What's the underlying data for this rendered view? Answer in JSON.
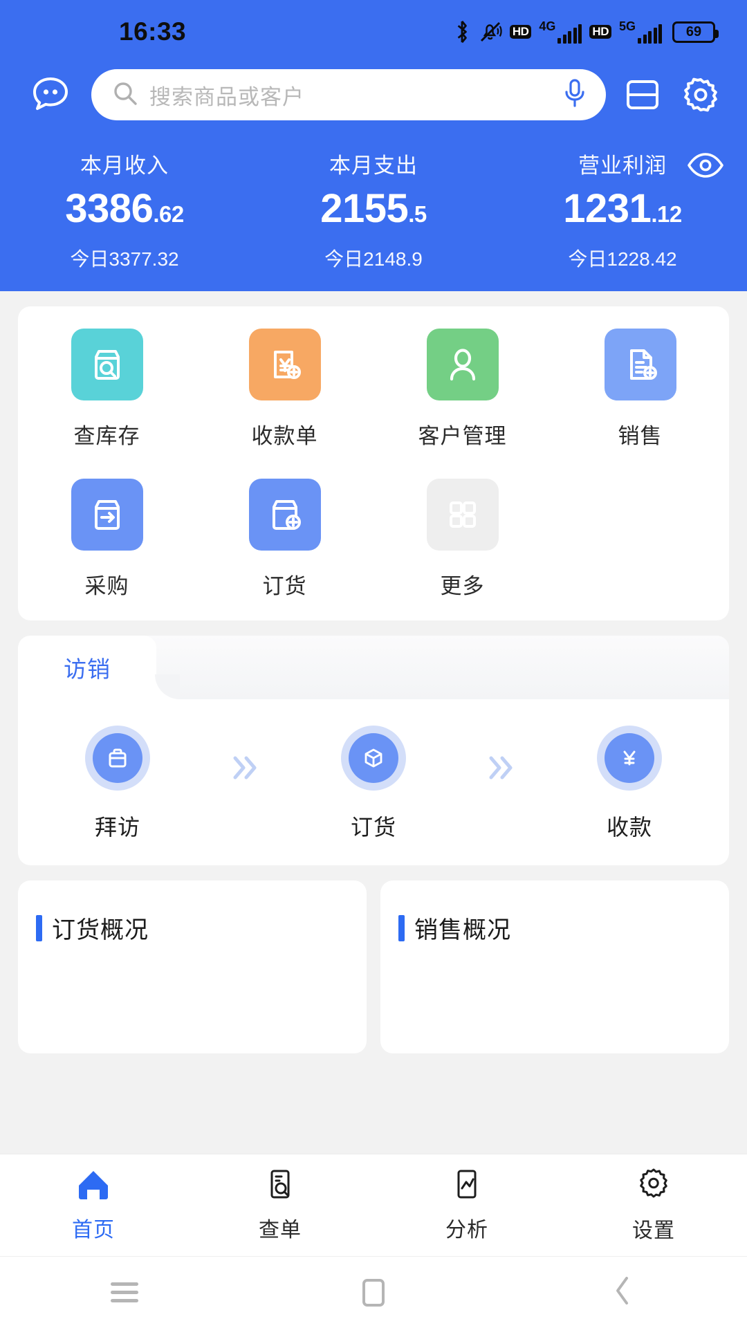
{
  "statusbar": {
    "time": "16:33",
    "icons": [
      "bluetooth-icon",
      "mute-vibrate-icon",
      "hd-icon",
      "signal-4g-icon",
      "hd-icon-2",
      "signal-5g-icon",
      "battery-icon"
    ],
    "network_1": "4G",
    "network_2": "5G",
    "hd_label": "HD",
    "battery_level": "69"
  },
  "header": {
    "chat_icon": "chat-bubble-icon",
    "search": {
      "placeholder": "搜索商品或客户",
      "search_icon": "search-icon",
      "mic_icon": "microphone-icon"
    },
    "scan_icon": "scan-card-icon",
    "settings_icon": "gear-icon",
    "eye_icon": "eye-visibility-icon",
    "accent_color": "#3b6ef0",
    "stats": [
      {
        "label": "本月收入",
        "int": "3386",
        "dec": ".62",
        "sub": "今日3377.32"
      },
      {
        "label": "本月支出",
        "int": "2155",
        "dec": ".5",
        "sub": "今日2148.9"
      },
      {
        "label": "营业利润",
        "int": "1231",
        "dec": ".12",
        "sub": "今日1228.42"
      }
    ]
  },
  "quick_actions": {
    "row1": [
      {
        "label": "查库存",
        "icon": "box-search-icon",
        "color": "#59d2d8"
      },
      {
        "label": "收款单",
        "icon": "receipt-yen-plus-icon",
        "color": "#f7a863"
      },
      {
        "label": "客户管理",
        "icon": "person-icon",
        "color": "#74cf85"
      },
      {
        "label": "销售",
        "icon": "document-plus-icon",
        "color": "#7da4f7"
      }
    ],
    "row2": [
      {
        "label": "采购",
        "icon": "box-arrow-right-icon",
        "color": "#6a93f5"
      },
      {
        "label": "订货",
        "icon": "box-plus-icon",
        "color": "#6a93f5"
      },
      {
        "label": "更多",
        "icon": "grid-more-icon",
        "color": "#eeeeee"
      }
    ]
  },
  "visit_sale": {
    "tab_label": "访销",
    "separator_icon": "chevron-double-right-icon",
    "steps": [
      {
        "label": "拜访",
        "icon": "briefcase-icon"
      },
      {
        "label": "订货",
        "icon": "package-box-icon"
      },
      {
        "label": "收款",
        "icon": "yen-coin-icon"
      }
    ]
  },
  "summary_cards": [
    {
      "title": "订货概况",
      "accent": "#2d6bf3"
    },
    {
      "title": "销售概况",
      "accent": "#2d6bf3"
    }
  ],
  "tabbar": [
    {
      "label": "首页",
      "icon": "home-icon",
      "active": true
    },
    {
      "label": "查单",
      "icon": "doc-search-icon",
      "active": false
    },
    {
      "label": "分析",
      "icon": "chart-line-icon",
      "active": false
    },
    {
      "label": "设置",
      "icon": "gear-icon",
      "active": false
    }
  ],
  "android_nav": {
    "menu_icon": "menu-icon",
    "home_icon": "home-square-icon",
    "back_icon": "back-chevron-icon"
  }
}
